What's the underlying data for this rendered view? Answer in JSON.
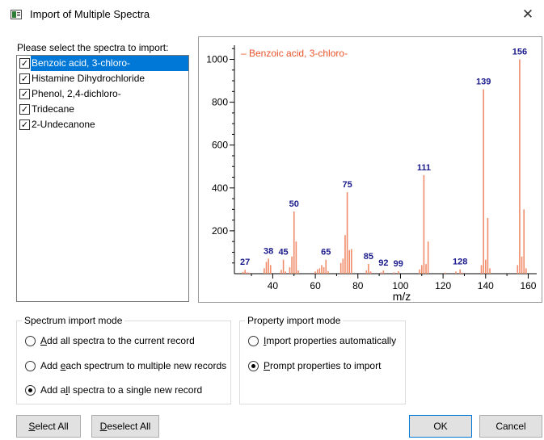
{
  "window": {
    "title": "Import of Multiple Spectra",
    "close_glyph": "✕"
  },
  "list": {
    "label": "Please select the spectra to import:",
    "items": [
      {
        "label": "Benzoic acid, 3-chloro-",
        "checked": true,
        "selected": true
      },
      {
        "label": "Histamine Dihydrochloride",
        "checked": true,
        "selected": false
      },
      {
        "label": "Phenol, 2,4-dichloro-",
        "checked": true,
        "selected": false
      },
      {
        "label": "Tridecane",
        "checked": true,
        "selected": false
      },
      {
        "label": "2-Undecanone",
        "checked": true,
        "selected": false
      }
    ]
  },
  "chart_data": {
    "type": "bar",
    "legend": "– Benzoic acid, 3-chloro-",
    "xlabel": "m/z",
    "ylabel": "",
    "xlim": [
      22,
      164
    ],
    "ylim": [
      0,
      1080
    ],
    "xticks": [
      40,
      60,
      80,
      100,
      120,
      140,
      160
    ],
    "yticks": [
      200,
      400,
      600,
      800,
      1000
    ],
    "bar_color": "#f08c6a",
    "label_color": "#1a1a8c",
    "peaks": [
      [
        26,
        8
      ],
      [
        27,
        18
      ],
      [
        28,
        6
      ],
      [
        29,
        4
      ],
      [
        36,
        25
      ],
      [
        37,
        55
      ],
      [
        38,
        70
      ],
      [
        39,
        40
      ],
      [
        44,
        18
      ],
      [
        45,
        65
      ],
      [
        46,
        10
      ],
      [
        48,
        30
      ],
      [
        49,
        80
      ],
      [
        50,
        290
      ],
      [
        51,
        150
      ],
      [
        52,
        15
      ],
      [
        60,
        10
      ],
      [
        61,
        20
      ],
      [
        62,
        25
      ],
      [
        63,
        40
      ],
      [
        64,
        30
      ],
      [
        65,
        65
      ],
      [
        66,
        12
      ],
      [
        72,
        50
      ],
      [
        73,
        70
      ],
      [
        74,
        180
      ],
      [
        75,
        380
      ],
      [
        76,
        110
      ],
      [
        77,
        115
      ],
      [
        84,
        15
      ],
      [
        85,
        45
      ],
      [
        86,
        10
      ],
      [
        91,
        6
      ],
      [
        92,
        15
      ],
      [
        97,
        6
      ],
      [
        99,
        12
      ],
      [
        109,
        20
      ],
      [
        110,
        40
      ],
      [
        111,
        460
      ],
      [
        112,
        45
      ],
      [
        113,
        150
      ],
      [
        121,
        5
      ],
      [
        126,
        10
      ],
      [
        128,
        20
      ],
      [
        129,
        5
      ],
      [
        138,
        40
      ],
      [
        139,
        860
      ],
      [
        140,
        65
      ],
      [
        141,
        260
      ],
      [
        142,
        25
      ],
      [
        155,
        40
      ],
      [
        156,
        1000
      ],
      [
        157,
        80
      ],
      [
        158,
        300
      ],
      [
        159,
        25
      ]
    ],
    "peak_labels": [
      {
        "mz": 27,
        "intensity": 18,
        "text": "27"
      },
      {
        "mz": 38,
        "intensity": 70,
        "text": "38"
      },
      {
        "mz": 45,
        "intensity": 65,
        "text": "45"
      },
      {
        "mz": 50,
        "intensity": 290,
        "text": "50"
      },
      {
        "mz": 65,
        "intensity": 65,
        "text": "65"
      },
      {
        "mz": 75,
        "intensity": 380,
        "text": "75"
      },
      {
        "mz": 85,
        "intensity": 45,
        "text": "85"
      },
      {
        "mz": 92,
        "intensity": 15,
        "text": "92"
      },
      {
        "mz": 99,
        "intensity": 12,
        "text": "99"
      },
      {
        "mz": 111,
        "intensity": 460,
        "text": "111"
      },
      {
        "mz": 128,
        "intensity": 20,
        "text": "128"
      },
      {
        "mz": 139,
        "intensity": 860,
        "text": "139"
      },
      {
        "mz": 156,
        "intensity": 1000,
        "text": "156"
      }
    ]
  },
  "spectrum_mode": {
    "title": "Spectrum import mode",
    "options": [
      {
        "pre": "",
        "acc": "A",
        "post": "dd all spectra to the current record",
        "selected": false
      },
      {
        "pre": "Add ",
        "acc": "e",
        "post": "ach spectrum to multiple new records",
        "selected": false
      },
      {
        "pre": "Add a",
        "acc": "l",
        "post": "l spectra to a single new record",
        "selected": true
      }
    ]
  },
  "property_mode": {
    "title": "Property import mode",
    "options": [
      {
        "pre": "",
        "acc": "I",
        "post": "mport properties automatically",
        "selected": false
      },
      {
        "pre": "",
        "acc": "P",
        "post": "rompt properties to import",
        "selected": true
      }
    ]
  },
  "buttons": {
    "select_all": {
      "acc": "S",
      "rest": "elect All"
    },
    "deselect_all": {
      "acc": "D",
      "rest": "eselect All"
    },
    "ok": "OK",
    "cancel": "Cancel"
  }
}
